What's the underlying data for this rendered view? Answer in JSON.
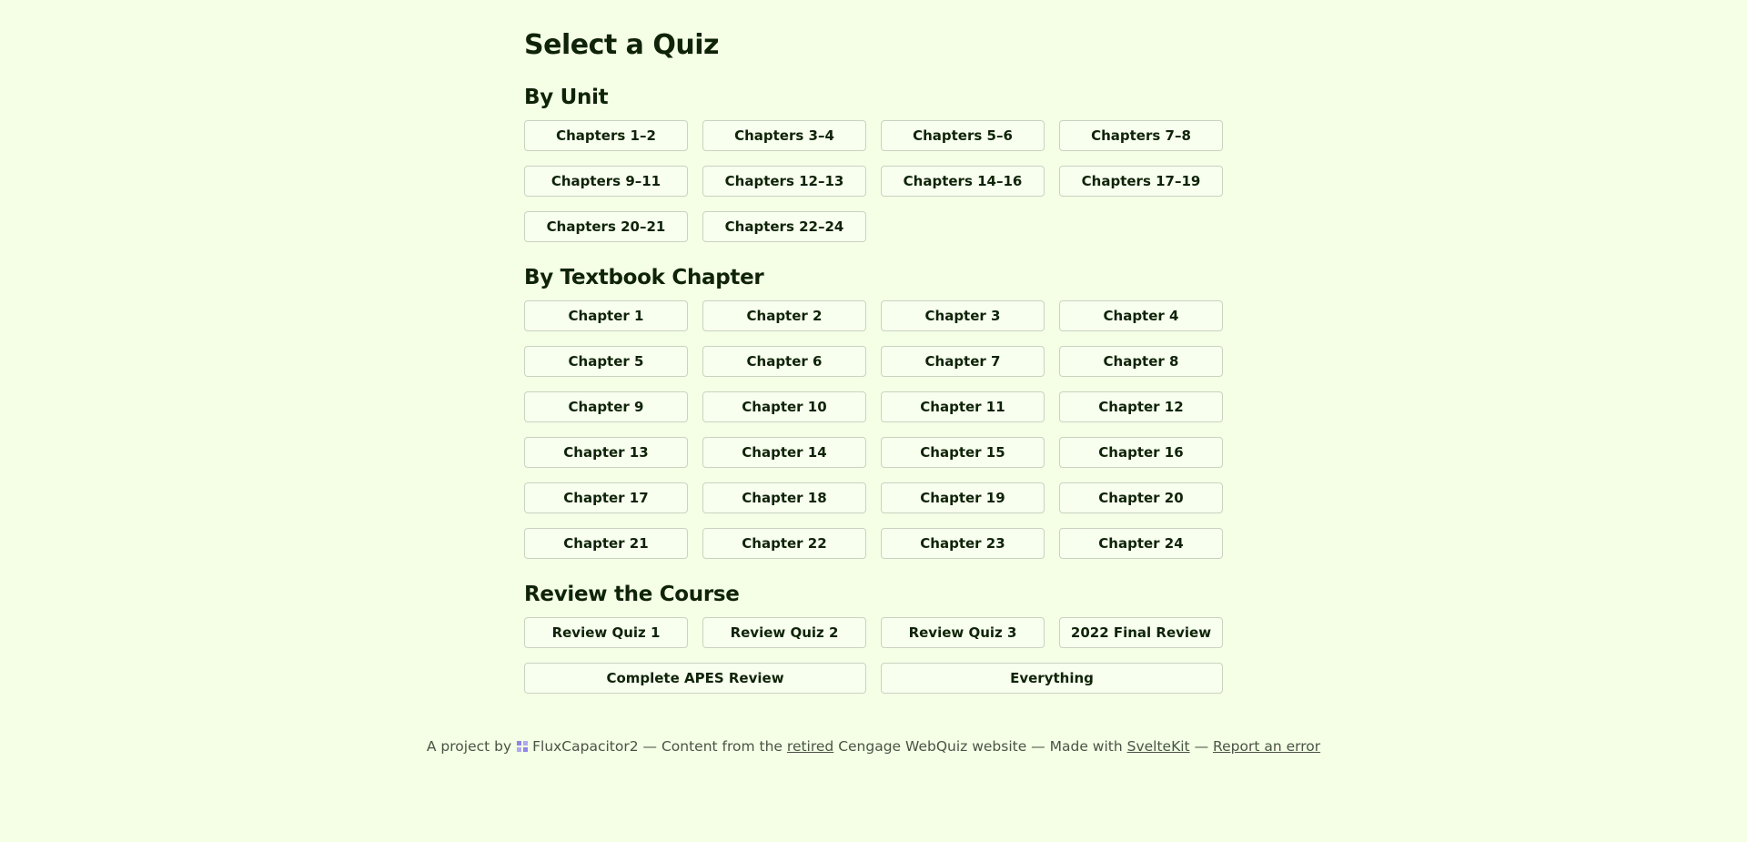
{
  "page_title": "Select a Quiz",
  "sections": {
    "by_unit": {
      "heading": "By Unit",
      "buttons": [
        "Chapters 1–2",
        "Chapters 3–4",
        "Chapters 5–6",
        "Chapters 7–8",
        "Chapters 9–11",
        "Chapters 12–13",
        "Chapters 14–16",
        "Chapters 17–19",
        "Chapters 20–21",
        "Chapters 22–24"
      ]
    },
    "by_chapter": {
      "heading": "By Textbook Chapter",
      "buttons": [
        "Chapter 1",
        "Chapter 2",
        "Chapter 3",
        "Chapter 4",
        "Chapter 5",
        "Chapter 6",
        "Chapter 7",
        "Chapter 8",
        "Chapter 9",
        "Chapter 10",
        "Chapter 11",
        "Chapter 12",
        "Chapter 13",
        "Chapter 14",
        "Chapter 15",
        "Chapter 16",
        "Chapter 17",
        "Chapter 18",
        "Chapter 19",
        "Chapter 20",
        "Chapter 21",
        "Chapter 22",
        "Chapter 23",
        "Chapter 24"
      ]
    },
    "review": {
      "heading": "Review the Course",
      "buttons": [
        "Review Quiz 1",
        "Review Quiz 2",
        "Review Quiz 3",
        "2022 Final Review"
      ],
      "wide_buttons": [
        "Complete APES Review",
        "Everything"
      ]
    }
  },
  "footer": {
    "prefix": "A project by",
    "author": "FluxCapacitor2",
    "content_from": "— Content from the",
    "retired_link": "retired",
    "source_text": "Cengage WebQuiz website — Made with",
    "sveltekit_link": "SvelteKit",
    "dash": "—",
    "report_link": "Report an error"
  },
  "colors": {
    "background": "#f4ffe6",
    "text": "#0f2308",
    "button_border": "#c9d3c0",
    "footer_text": "#4a5445",
    "author_icon": "#8f86e8"
  },
  "icons": {
    "author_icon": "flux-capacitor-icon"
  }
}
